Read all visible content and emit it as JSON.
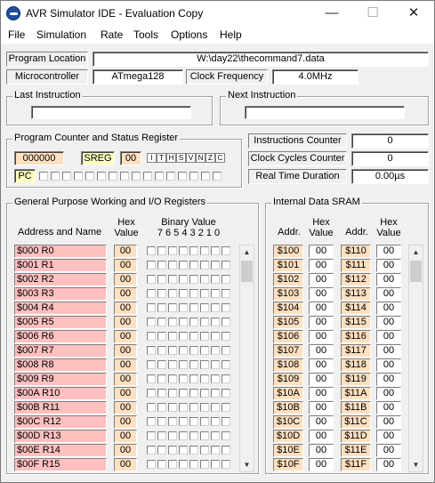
{
  "window": {
    "title": "AVR Simulator IDE - Evaluation Copy",
    "minimize": "—",
    "maximize": "☐",
    "close": "✕"
  },
  "menu": [
    "File",
    "Simulation",
    "Rate",
    "Tools",
    "Options",
    "Help"
  ],
  "program_location": {
    "label": "Program Location",
    "value": "W:\\day22\\thecommand7.data"
  },
  "microcontroller": {
    "label": "Microcontroller",
    "value": "ATmega128"
  },
  "clock_frequency": {
    "label": "Clock Frequency",
    "value": "4.0MHz"
  },
  "last_instruction": {
    "title": "Last Instruction",
    "value": ""
  },
  "next_instruction": {
    "title": "Next Instruction",
    "value": ""
  },
  "pc_status": {
    "title": "Program Counter and Status Register",
    "pc_value": "000000",
    "sreg_label": "SREG",
    "sreg_value": "00",
    "flags": [
      "I",
      "T",
      "H",
      "S",
      "V",
      "N",
      "Z",
      "C"
    ],
    "pc_label": "PC"
  },
  "counters": {
    "instructions": {
      "label": "Instructions Counter",
      "value": "0"
    },
    "clock_cycles": {
      "label": "Clock Cycles Counter",
      "value": "0"
    },
    "real_time": {
      "label": "Real Time Duration",
      "value": "0.00µs"
    }
  },
  "gpr": {
    "title": "General Purpose Working and I/O Registers",
    "col_address": "Address and Name",
    "col_hex1": "Hex",
    "col_hex2": "Value",
    "col_binary": "Binary Value",
    "col_bits": "7 6 5 4 3 2 1 0",
    "rows": [
      {
        "name": "$000  R0",
        "value": "00"
      },
      {
        "name": "$001  R1",
        "value": "00"
      },
      {
        "name": "$002  R2",
        "value": "00"
      },
      {
        "name": "$003  R3",
        "value": "00"
      },
      {
        "name": "$004  R4",
        "value": "00"
      },
      {
        "name": "$005  R5",
        "value": "00"
      },
      {
        "name": "$006  R6",
        "value": "00"
      },
      {
        "name": "$007  R7",
        "value": "00"
      },
      {
        "name": "$008  R8",
        "value": "00"
      },
      {
        "name": "$009  R9",
        "value": "00"
      },
      {
        "name": "$00A  R10",
        "value": "00"
      },
      {
        "name": "$00B  R11",
        "value": "00"
      },
      {
        "name": "$00C  R12",
        "value": "00"
      },
      {
        "name": "$00D  R13",
        "value": "00"
      },
      {
        "name": "$00E  R14",
        "value": "00"
      },
      {
        "name": "$00F  R15",
        "value": "00"
      }
    ]
  },
  "sram": {
    "title": "Internal Data SRAM",
    "col_addr": "Addr.",
    "col_hex1": "Hex",
    "col_hex2": "Value",
    "rows": [
      {
        "a1": "$100",
        "v1": "00",
        "a2": "$110",
        "v2": "00"
      },
      {
        "a1": "$101",
        "v1": "00",
        "a2": "$111",
        "v2": "00"
      },
      {
        "a1": "$102",
        "v1": "00",
        "a2": "$112",
        "v2": "00"
      },
      {
        "a1": "$103",
        "v1": "00",
        "a2": "$113",
        "v2": "00"
      },
      {
        "a1": "$104",
        "v1": "00",
        "a2": "$114",
        "v2": "00"
      },
      {
        "a1": "$105",
        "v1": "00",
        "a2": "$115",
        "v2": "00"
      },
      {
        "a1": "$106",
        "v1": "00",
        "a2": "$116",
        "v2": "00"
      },
      {
        "a1": "$107",
        "v1": "00",
        "a2": "$117",
        "v2": "00"
      },
      {
        "a1": "$108",
        "v1": "00",
        "a2": "$118",
        "v2": "00"
      },
      {
        "a1": "$109",
        "v1": "00",
        "a2": "$119",
        "v2": "00"
      },
      {
        "a1": "$10A",
        "v1": "00",
        "a2": "$11A",
        "v2": "00"
      },
      {
        "a1": "$10B",
        "v1": "00",
        "a2": "$11B",
        "v2": "00"
      },
      {
        "a1": "$10C",
        "v1": "00",
        "a2": "$11C",
        "v2": "00"
      },
      {
        "a1": "$10D",
        "v1": "00",
        "a2": "$11D",
        "v2": "00"
      },
      {
        "a1": "$10E",
        "v1": "00",
        "a2": "$11E",
        "v2": "00"
      },
      {
        "a1": "$10F",
        "v1": "00",
        "a2": "$11F",
        "v2": "00"
      }
    ]
  },
  "colors": {
    "register_name_bg": "#ffc0c0",
    "register_value_bg": "#ffe0c0",
    "window_bg": "#f0f0f0"
  }
}
